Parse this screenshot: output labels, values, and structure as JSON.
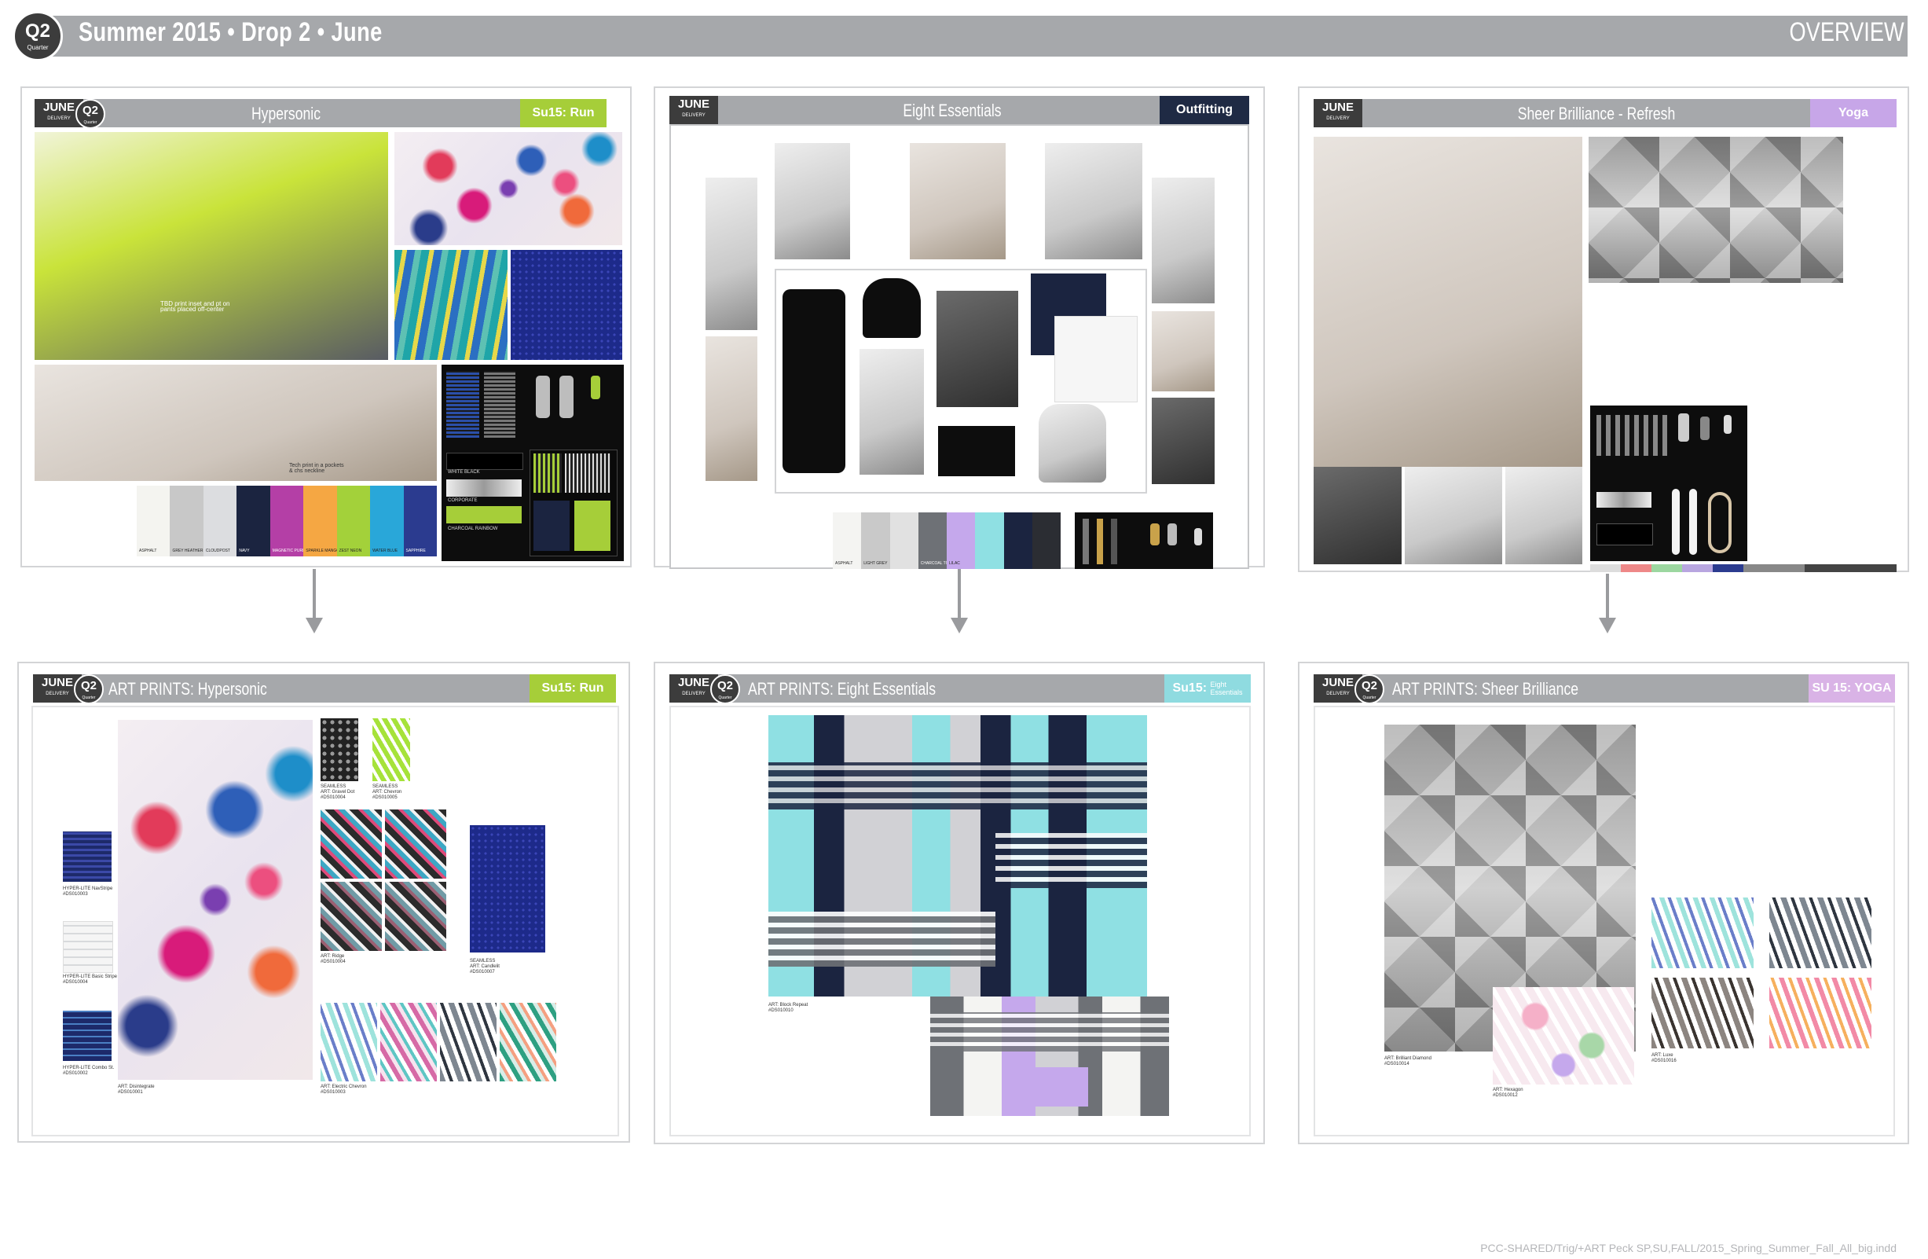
{
  "header": {
    "quarter": "Q2",
    "quarter_sub": "Quarter",
    "title": "Summer 2015 • Drop 2 • June",
    "right_label": "OVERVIEW"
  },
  "panels": {
    "hypersonic": {
      "month": "JUNE",
      "month_sub": "DELIVERY",
      "quarter": "Q2",
      "quarter_sub": "Quarter",
      "title": "Hypersonic",
      "tag": "Su15: Run",
      "tag_color": "#a6ce39"
    },
    "eight": {
      "month": "JUNE",
      "month_sub": "DELIVERY",
      "title": "Eight Essentials",
      "tag": "Outfitting",
      "tag_color": "#1f2a44"
    },
    "sheer": {
      "month": "JUNE",
      "month_sub": "DELIVERY",
      "title": "Sheer Brilliance - Refresh",
      "tag": "Yoga",
      "tag_color": "#c7a6e8"
    },
    "art_hypersonic": {
      "month": "JUNE",
      "month_sub": "DELIVERY",
      "quarter": "Q2",
      "quarter_sub": "Quarter",
      "title": "ART PRINTS: Hypersonic",
      "tag": "Su15: Run",
      "tag_color": "#a6ce39"
    },
    "art_eight": {
      "month": "JUNE",
      "month_sub": "DELIVERY",
      "quarter": "Q2",
      "quarter_sub": "Quarter",
      "title": "ART PRINTS: Eight Essentials",
      "tag_main": "Su15:",
      "tag_sub1": "Eight",
      "tag_sub2": "Essentials",
      "tag_color": "#8fdbe0"
    },
    "art_sheer": {
      "month": "JUNE",
      "month_sub": "DELIVERY",
      "quarter": "Q2",
      "quarter_sub": "Quarter",
      "title": "ART PRINTS: Sheer Brilliance",
      "tag": "SU 15: YOGA",
      "tag_color": "#d9b3e6"
    }
  },
  "swatches": {
    "hypersonic": [
      {
        "name": "ASPHALT",
        "color": "#f4f4f0"
      },
      {
        "name": "GREY HEATHER",
        "color": "#c8c8c8"
      },
      {
        "name": "CLOUDPOST",
        "color": "#dcdde0"
      },
      {
        "name": "NAVY",
        "color": "#1b2440"
      },
      {
        "name": "MAGNETIC PURPLE",
        "color": "#b43fa6"
      },
      {
        "name": "SPARKLE MANGO",
        "color": "#f5a743"
      },
      {
        "name": "ZEST NEON",
        "color": "#a3d13a"
      },
      {
        "name": "WATER BLUE",
        "color": "#29a7d9"
      },
      {
        "name": "SAPPHIRE",
        "color": "#2b3b8f"
      }
    ],
    "eight": [
      {
        "name": "ASPHALT",
        "color": "#f4f4f2"
      },
      {
        "name": "LIGHT GREY",
        "color": "#c9c9c9"
      },
      {
        "name": "",
        "color": "#e1e1e1"
      },
      {
        "name": "CHARCOAL TONE",
        "color": "#6e7176"
      },
      {
        "name": "LILAC",
        "color": "#c5a8ec"
      },
      {
        "name": "",
        "color": "#8fe0e3"
      },
      {
        "name": "",
        "color": "#1b2440"
      },
      {
        "name": "",
        "color": "#2b2d33"
      }
    ]
  },
  "art_labels": {
    "hypersonic_main": [
      "ART: Disintegrate",
      "#DS010001"
    ],
    "seamless1": [
      "SEAMLESS",
      "ART: Gravel Dot",
      "#DS010004"
    ],
    "seamless2": [
      "SEAMLESS",
      "ART: Chevron",
      "#DS010005"
    ],
    "stripe1": [
      "HYPER-LITE NavStripe",
      "#DS010003"
    ],
    "stripe2": [
      "HYPER-LITE Basic Stripe",
      "#DS010004"
    ],
    "stripe3": [
      "HYPER-LITE Combo St.",
      "#DS010002"
    ],
    "pattern": [
      "ART: Ridge",
      "#DS010004"
    ],
    "chevron_blurb": [
      "ART: Electric Chevron",
      "#DS010003"
    ],
    "dot": [
      "SEAMLESS",
      "ART: Candlelit",
      "#DS010007"
    ],
    "eight_main": [
      "ART: Block Repeat",
      "#DS010010"
    ],
    "sheer_main": [
      "ART: Brilliant Diamond",
      "#DS010014"
    ],
    "sheer_hex": [
      "ART: Hexagon",
      "#DS010012"
    ],
    "sheer_luxe": [
      "ART: Luxe",
      "#DS010016"
    ]
  },
  "photo_captions": {
    "hypersonic_photo": "TBD print inset and pt on pants placed off-center",
    "hypersonic_photo2": "Tech print in a pockets & chs neckline",
    "hardware1": "WHITE BLACK",
    "hardware2": "CORPORATE",
    "hardware3": "CHARCOAL RAINBOW"
  },
  "footer": "PCC-SHARED/Trig/+ART Peck SP,SU,FALL/2015_Spring_Summer_Fall_All_big.indd"
}
